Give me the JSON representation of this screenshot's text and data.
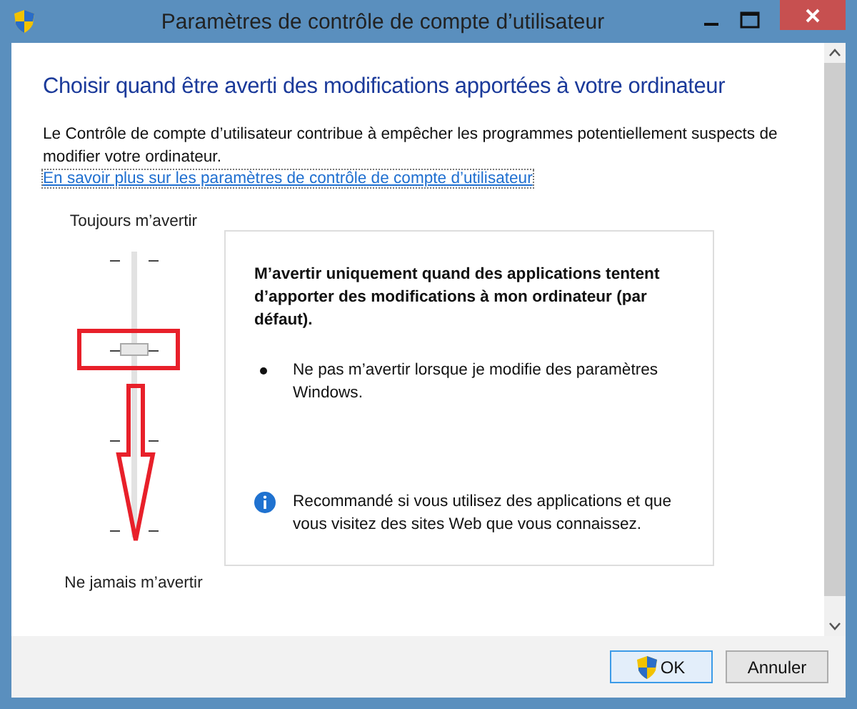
{
  "window": {
    "title": "Paramètres de contrôle de compte d’utilisateur"
  },
  "heading": "Choisir quand être averti des modifications apportées à votre ordinateur",
  "description": "Le Contrôle de compte d’utilisateur contribue à empêcher les programmes potentiellement suspects de modifier votre ordinateur.",
  "link": "En savoir plus sur les paramètres de contrôle de compte d’utilisateur",
  "slider": {
    "top_label": "Toujours m’avertir",
    "bottom_label": "Ne jamais m’avertir",
    "level": 0.667
  },
  "panel": {
    "title": "M’avertir uniquement quand des applications tentent d’apporter des modifications à mon ordinateur (par défaut).",
    "bullets": [
      "Ne pas m’avertir lorsque je modifie des paramètres Windows."
    ],
    "note": "Recommandé si vous utilisez des applications et que vous visitez des sites Web que vous connaissez."
  },
  "buttons": [
    {
      "label": "OK",
      "kind": "shield",
      "default": true
    },
    {
      "label": "Annuler",
      "kind": "plain",
      "default": false
    }
  ]
}
